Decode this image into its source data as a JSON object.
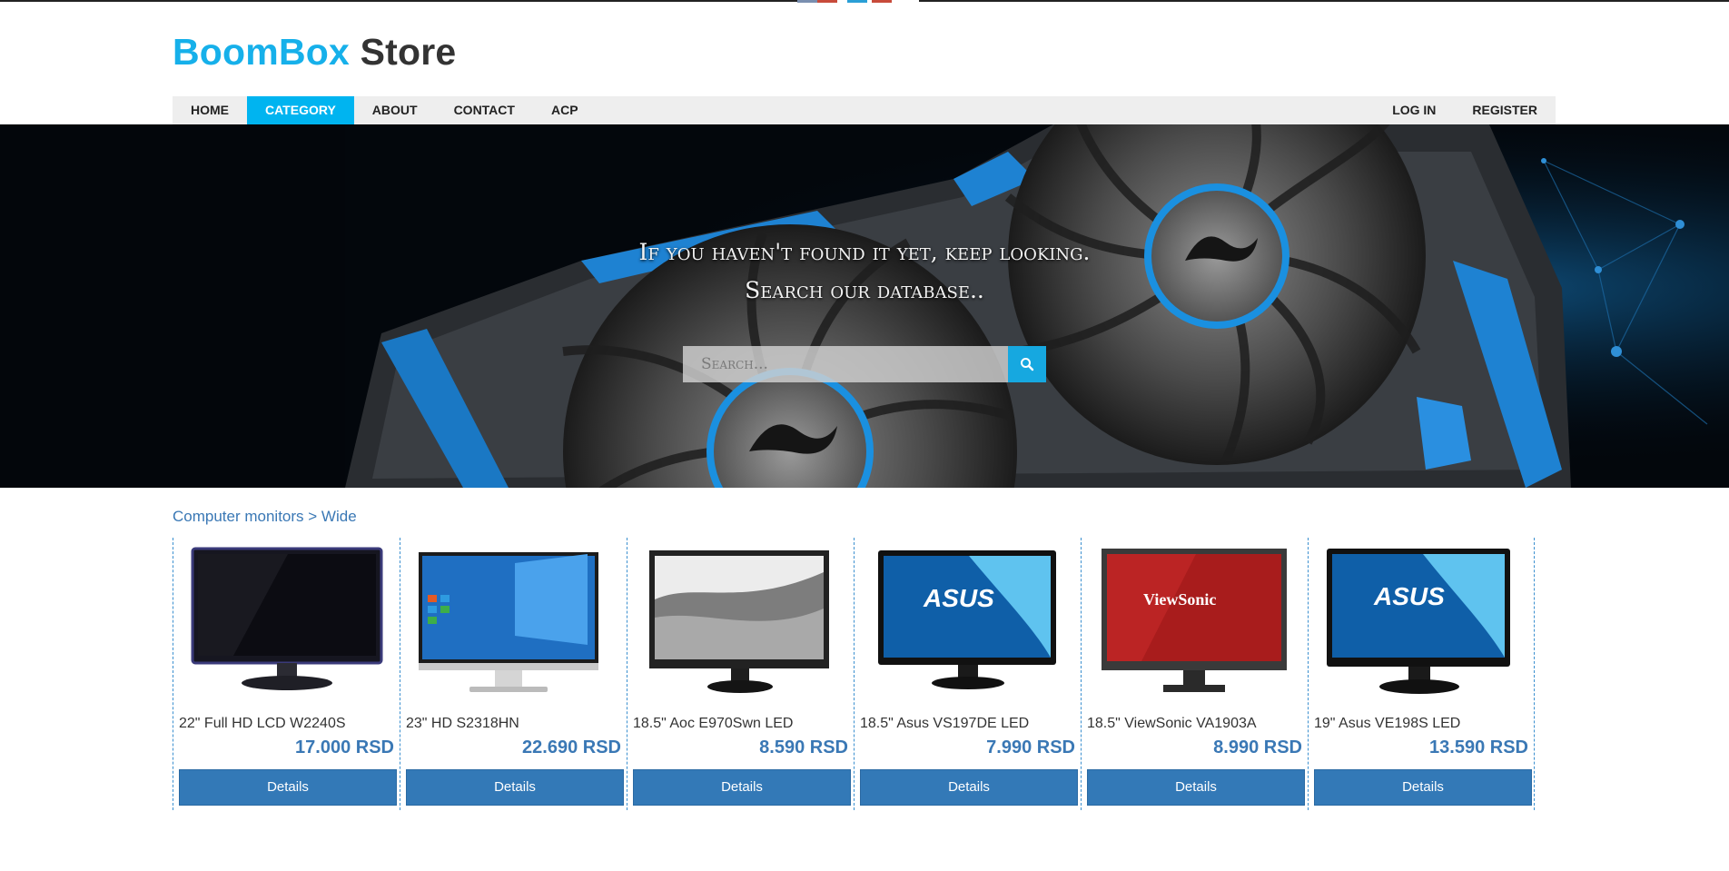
{
  "colors": {
    "brand": "#16b0ea",
    "nav_active": "#00b4f0",
    "button": "#3379b7",
    "price": "#3a78b5"
  },
  "logo": {
    "part1": "BoomBox",
    "part2": "Store"
  },
  "nav": {
    "left": [
      {
        "label": "HOME",
        "active": false
      },
      {
        "label": "CATEGORY",
        "active": true
      },
      {
        "label": "ABOUT",
        "active": false
      },
      {
        "label": "CONTACT",
        "active": false
      },
      {
        "label": "ACP",
        "active": false
      }
    ],
    "right": [
      {
        "label": "LOG IN"
      },
      {
        "label": "REGISTER"
      }
    ]
  },
  "hero": {
    "line1": "If you haven't found it yet, keep looking.",
    "line2": "Search our database..",
    "search_placeholder": "Search...",
    "search_icon": "search-icon"
  },
  "breadcrumb": "Computer monitors > Wide",
  "products": [
    {
      "name": "22\" Full HD LCD W2240S",
      "price": "17.000 RSD",
      "button": "Details"
    },
    {
      "name": "23\" HD S2318HN",
      "price": "22.690 RSD",
      "button": "Details"
    },
    {
      "name": "18.5\" Aoc E970Swn LED",
      "price": "8.590 RSD",
      "button": "Details"
    },
    {
      "name": "18.5\" Asus VS197DE LED",
      "price": "7.990 RSD",
      "button": "Details"
    },
    {
      "name": "18.5\" ViewSonic VA1903A",
      "price": "8.990 RSD",
      "button": "Details"
    },
    {
      "name": "19\" Asus VE198S LED",
      "price": "13.590 RSD",
      "button": "Details"
    }
  ]
}
